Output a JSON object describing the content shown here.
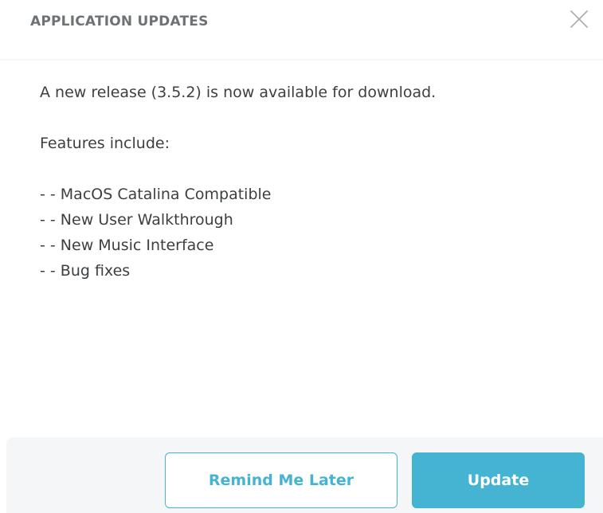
{
  "dialog": {
    "title": "APPLICATION UPDATES",
    "close_icon": "close-icon"
  },
  "content": {
    "intro": "A new release (3.5.2) is now available for download.",
    "features_heading": "Features include:",
    "features": [
      "- - MacOS Catalina Compatible",
      "- - New User Walkthrough",
      "- - New Music Interface",
      "- - Bug fixes"
    ]
  },
  "footer": {
    "remind_label": "Remind Me Later",
    "update_label": "Update"
  },
  "colors": {
    "accent": "#45b3d2",
    "title_text": "#6f7275",
    "body_text": "#3c3f42",
    "footer_bg": "#f5f6f7"
  }
}
